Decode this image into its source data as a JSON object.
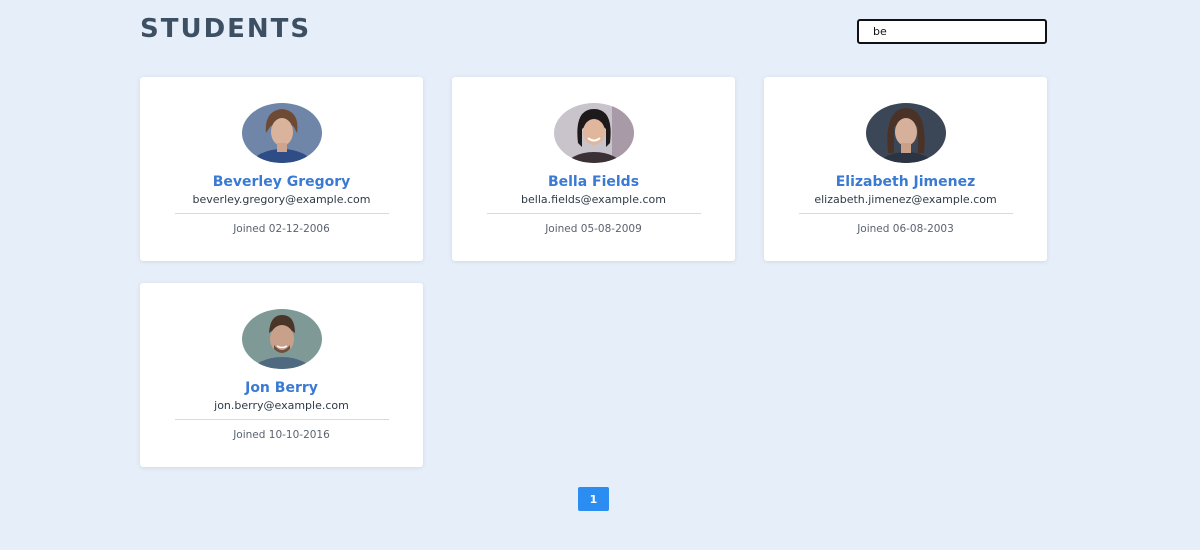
{
  "header": {
    "title": "STUDENTS"
  },
  "search": {
    "value": "be",
    "placeholder": ""
  },
  "joined_prefix": "Joined ",
  "students": [
    {
      "name": "Beverley Gregory",
      "email": "beverley.gregory@example.com",
      "joined": "02-12-2006",
      "avatar_tone": "#2e4c86"
    },
    {
      "name": "Bella Fields",
      "email": "bella.fields@example.com",
      "joined": "05-08-2009",
      "avatar_tone": "#8f7e86"
    },
    {
      "name": "Elizabeth Jimenez",
      "email": "elizabeth.jimenez@example.com",
      "joined": "06-08-2003",
      "avatar_tone": "#2a3442"
    },
    {
      "name": "Jon Berry",
      "email": "jon.berry@example.com",
      "joined": "10-10-2016",
      "avatar_tone": "#5b7880"
    }
  ],
  "pagination": {
    "pages": [
      "1"
    ],
    "current": "1"
  },
  "colors": {
    "background": "#e6eef9",
    "accent": "#3a7ad2",
    "page_button": "#2b8cf2",
    "title": "#3d4f63"
  }
}
